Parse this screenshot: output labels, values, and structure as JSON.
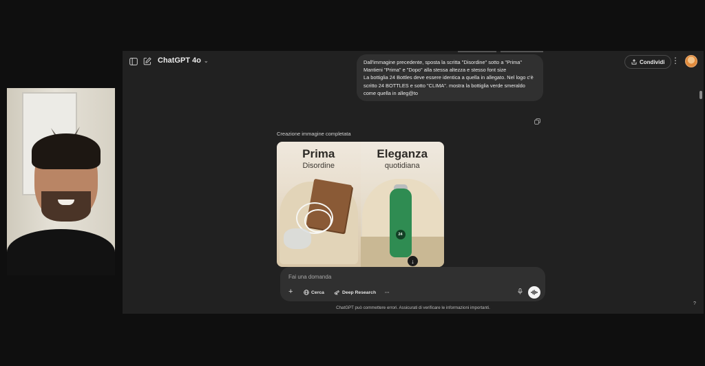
{
  "header": {
    "model_name": "ChatGPT 4o",
    "share_label": "Condividi"
  },
  "conversation": {
    "user_message_lines": [
      "Dall'immagine precedente, sposta la scritta \"Disordine\" sotto a \"Prima\"",
      "Mantieni \"Prima\" e \"Dopo\" alla stessa altezza e stesso font size",
      "La bottiglia 24 Bottles deve essere identica a quella in allegato. Nel logo c'è scritto 24 BOTTLES e sotto \"CLIMA\". mostra la bottiglia verde smeraldo come quella in alleg@to"
    ],
    "image_status": "Creazione immagine completata",
    "image": {
      "left_title": "Prima",
      "left_subtitle": "Disordine",
      "right_title": "Eleganza",
      "right_subtitle": "quotidiana",
      "bottle_logo_text": "24",
      "bottle_color": "#2f8c52"
    }
  },
  "composer": {
    "placeholder": "Fai una domanda",
    "tools": {
      "search_label": "Cerca",
      "research_label": "Deep Research",
      "more_label": "···"
    }
  },
  "footer": {
    "disclaimer": "ChatGPT può commettere errori. Assicurati di verificare le informazioni importanti.",
    "help_label": "?"
  },
  "icons": {
    "sidebar": "sidebar-toggle-icon",
    "new_chat": "new-chat-icon",
    "share": "share-icon",
    "kebab": "more-vertical-icon",
    "copy": "copy-icon",
    "download": "download-icon",
    "plus": "plus-icon",
    "globe": "globe-icon",
    "telescope": "telescope-icon",
    "mic": "microphone-icon",
    "voice": "voice-mode-icon"
  }
}
